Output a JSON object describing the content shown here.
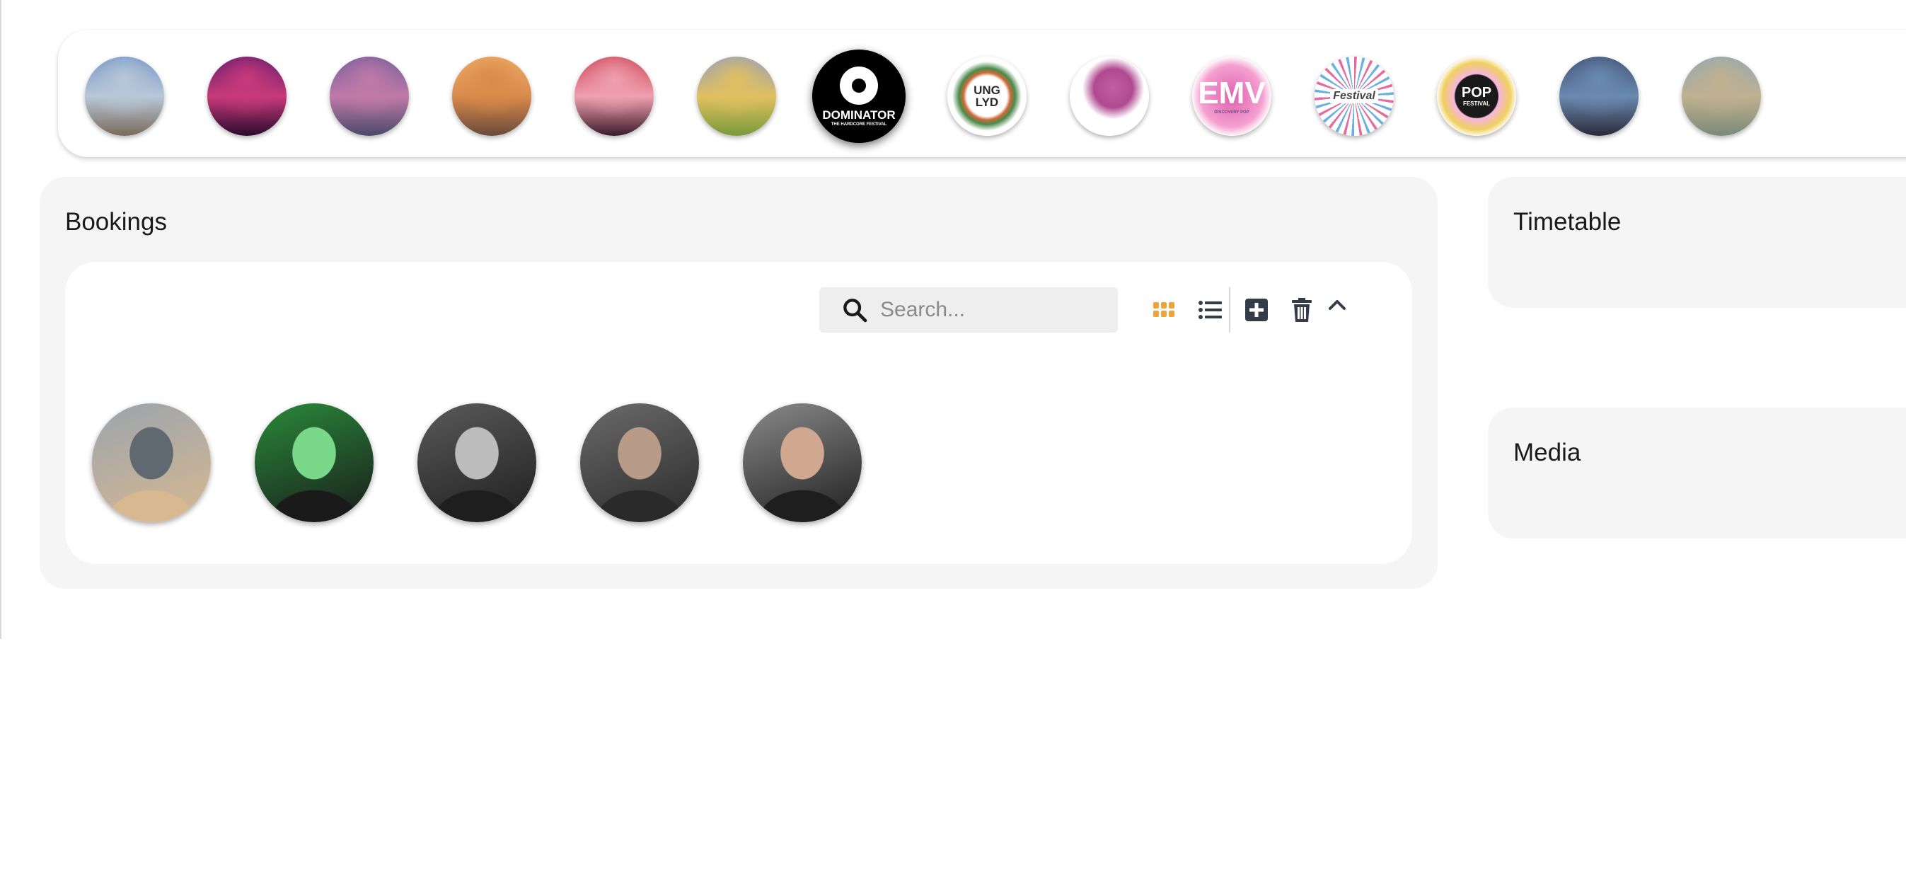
{
  "festivals": [
    {
      "name": "festival-photo-stage",
      "kind": "photo",
      "colors": [
        "#6b8fc4",
        "#b9c7d8",
        "#7a6a5a"
      ]
    },
    {
      "name": "festival-photo-lasers",
      "kind": "photo",
      "colors": [
        "#5a1a6e",
        "#c83a7a",
        "#2a0a2e"
      ]
    },
    {
      "name": "festival-photo-crowd-purple",
      "kind": "photo",
      "colors": [
        "#6a5a9a",
        "#c07aa8",
        "#4a4a6a"
      ]
    },
    {
      "name": "festival-photo-sunset",
      "kind": "photo",
      "colors": [
        "#f2b06a",
        "#d88a4a",
        "#6a4a3a"
      ]
    },
    {
      "name": "festival-photo-red-lights",
      "kind": "photo",
      "colors": [
        "#c83a4a",
        "#f0a0b0",
        "#3a1a2a"
      ]
    },
    {
      "name": "festival-photo-castle",
      "kind": "photo",
      "colors": [
        "#8a9ac8",
        "#e0c060",
        "#7a9a3a"
      ]
    },
    {
      "name": "festival-dominator",
      "kind": "logo",
      "text": "DOMINATOR",
      "subtext": "THE HARDCORE FESTIVAL",
      "bg": "#000000",
      "fg": "#ffffff",
      "selected": true
    },
    {
      "name": "festival-ung-lyd",
      "kind": "logo",
      "text": "UNG LYD",
      "bg": "#ffffff",
      "fg": "#2a2a2a"
    },
    {
      "name": "festival-purple-brain",
      "kind": "logo",
      "text": "",
      "bg": "#ffffff",
      "fg": "#b0508a"
    },
    {
      "name": "festival-emv",
      "kind": "logo",
      "text": "EMV",
      "subtext": "DISCOVERY POP",
      "bg": "#ffffff",
      "fg": "#ffffff"
    },
    {
      "name": "festival-festival",
      "kind": "logo",
      "text": "Festival",
      "bg": "#ffffff",
      "fg": "#444444"
    },
    {
      "name": "festival-pop",
      "kind": "logo",
      "text": "POP",
      "subtext": "FESTIVAL",
      "bg": "#ffffff",
      "fg": "#ffffff"
    },
    {
      "name": "festival-photo-night-dome",
      "kind": "photo",
      "colors": [
        "#3a4a6a",
        "#6a8ab0",
        "#2a2a3a"
      ]
    },
    {
      "name": "festival-photo-crowd-day",
      "kind": "photo",
      "colors": [
        "#8aa8b8",
        "#c0b090",
        "#7a8a7a"
      ]
    }
  ],
  "bookings": {
    "title": "Bookings",
    "search_placeholder": "Search...",
    "artists": [
      {
        "name": "artist-woman-blonde",
        "colors": [
          "#9aa4ae",
          "#d8b890",
          "#606870"
        ]
      },
      {
        "name": "artist-masked-green",
        "colors": [
          "#2a8a3a",
          "#1a1a1a",
          "#7ad88a"
        ]
      },
      {
        "name": "artist-hooded-mask",
        "colors": [
          "#5a5a5a",
          "#1e1e1e",
          "#bcbcbc"
        ]
      },
      {
        "name": "artist-screaming-man",
        "colors": [
          "#6a6a6a",
          "#2a2a2a",
          "#b89a88"
        ]
      },
      {
        "name": "artist-headphones-man",
        "colors": [
          "#8a8a8a",
          "#1e1e1e",
          "#d0a890"
        ]
      }
    ]
  },
  "timetable": {
    "title": "Timetable"
  },
  "media": {
    "title": "Media"
  },
  "colors": {
    "accent": "#f0a33a",
    "toolbar_icon": "#333d4a",
    "panel_bg": "#f5f5f5"
  },
  "toolbar": {
    "icons": [
      "grid-view-icon",
      "list-view-icon",
      "add-icon",
      "delete-icon",
      "collapse-icon"
    ]
  }
}
